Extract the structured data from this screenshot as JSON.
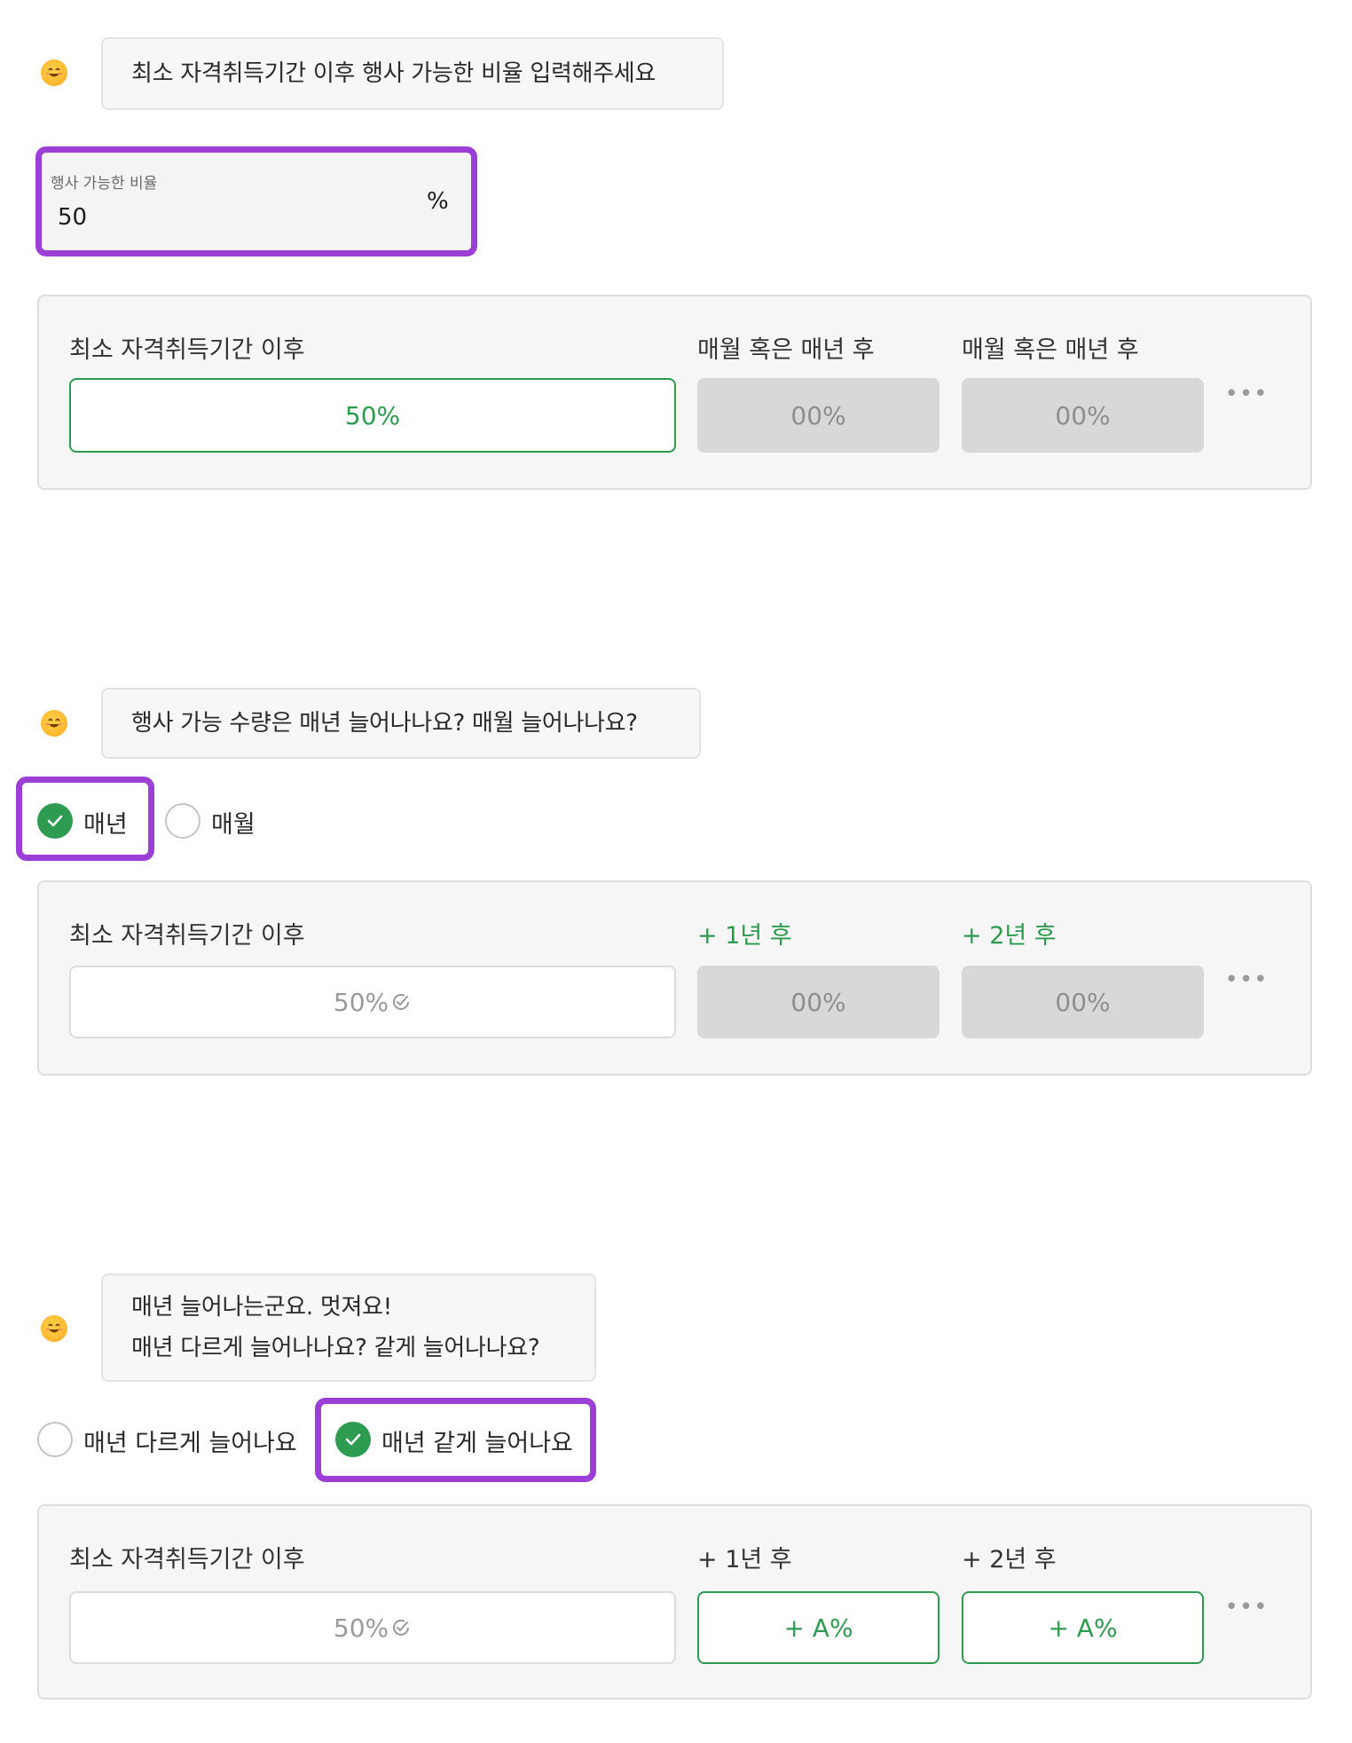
{
  "section1": {
    "question": "최소 자격취득기간 이후 행사 가능한 비율 입력해주세요",
    "input": {
      "caption": "행사 가능한 비율",
      "value": "50",
      "unit": "%"
    },
    "panel": {
      "labels": [
        "최소 자격취득기간 이후",
        "매월 혹은 매년 후",
        "매월 혹은 매년 후"
      ],
      "cells": [
        "50%",
        "00%",
        "00%"
      ],
      "more": "•••"
    }
  },
  "section2": {
    "question": "행사 가능 수량은 매년 늘어나나요? 매월 늘어나나요?",
    "options": [
      "매년",
      "매월"
    ],
    "selected": "매년",
    "panel": {
      "labels": [
        "최소 자격취득기간 이후",
        "+ 1년 후",
        "+ 2년 후"
      ],
      "cells": [
        "50%",
        "00%",
        "00%"
      ],
      "more": "•••"
    }
  },
  "section3": {
    "question_line1": "매년 늘어나는군요. 멋져요!",
    "question_line2": "매년 다르게 늘어나나요? 같게 늘어나나요?",
    "options": [
      "매년 다르게 늘어나요",
      "매년 같게 늘어나요"
    ],
    "selected": "매년 같게 늘어나요",
    "panel": {
      "labels": [
        "최소 자격취득기간 이후",
        "+ 1년 후",
        "+ 2년 후"
      ],
      "cells": [
        "50%",
        "+ A%",
        "+ A%"
      ],
      "more": "•••"
    }
  },
  "colors": {
    "accent_green": "#2e9c50",
    "highlight_purple": "#9b3fd6",
    "disabled_gray": "#d8d8d8"
  },
  "icons": [
    "smiling-face-emoji-icon",
    "check-icon",
    "check-circle-icon",
    "more-dots-icon"
  ]
}
